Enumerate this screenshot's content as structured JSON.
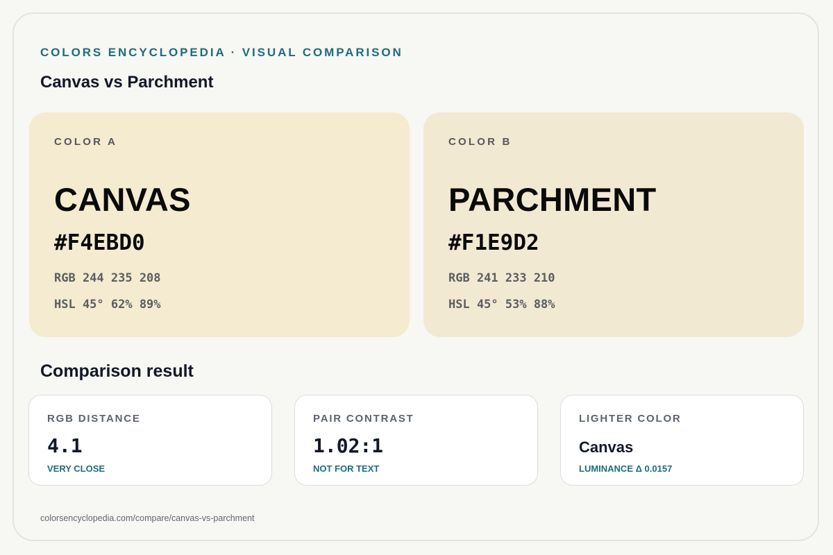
{
  "header": {
    "eyebrow": "COLORS ENCYCLOPEDIA · VISUAL COMPARISON",
    "title": "Canvas vs Parchment"
  },
  "colors": [
    {
      "label": "COLOR A",
      "name": "CANVAS",
      "hex": "#F4EBD0",
      "rgb": "RGB 244 235 208",
      "hsl": "HSL 45° 62% 89%",
      "swatch": "#F4EBD0"
    },
    {
      "label": "COLOR B",
      "name": "PARCHMENT",
      "hex": "#F1E9D2",
      "rgb": "RGB 241 233 210",
      "hsl": "HSL 45° 53% 88%",
      "swatch": "#F1E9D2"
    }
  ],
  "comparison": {
    "title": "Comparison result",
    "metrics": [
      {
        "label": "RGB DISTANCE",
        "value": "4.1",
        "note": "VERY CLOSE"
      },
      {
        "label": "PAIR CONTRAST",
        "value": "1.02:1",
        "note": "NOT FOR TEXT"
      },
      {
        "label": "LIGHTER COLOR",
        "value": "Canvas",
        "note": "LUMINANCE Δ 0.0157"
      }
    ]
  },
  "footer": {
    "url": "colorsencyclopedia.com/compare/canvas-vs-parchment"
  },
  "theme": {
    "accent": "#1D6C7D",
    "background": "#F7F7F3",
    "card_border": "#DCDDE0"
  }
}
